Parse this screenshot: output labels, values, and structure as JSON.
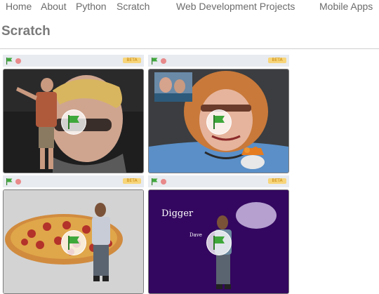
{
  "nav": {
    "items": [
      {
        "label": "Home"
      },
      {
        "label": "About"
      },
      {
        "label": "Python"
      },
      {
        "label": "Scratch"
      },
      {
        "label": "Web Development Projects"
      },
      {
        "label": "Mobile Apps"
      }
    ]
  },
  "page": {
    "title": "Scratch"
  },
  "players": [
    {
      "flag_icon": "green-flag-icon",
      "stop_icon": "stop-icon",
      "beta_icon": "beta-badge"
    },
    {
      "flag_icon": "green-flag-icon",
      "stop_icon": "stop-icon",
      "beta_icon": "beta-badge"
    },
    {
      "flag_icon": "green-flag-icon",
      "stop_icon": "stop-icon",
      "beta_icon": "beta-badge"
    },
    {
      "flag_icon": "green-flag-icon",
      "stop_icon": "stop-icon",
      "beta_icon": "beta-badge",
      "stage_title": "Digger",
      "stage_caption": "Dave"
    }
  ],
  "colors": {
    "nav_text": "#6b6b6b",
    "title_text": "#7a7a7a",
    "control_bar": "#e8ebef",
    "flag_green": "#3fa83b",
    "stop_red": "#e8898a",
    "beta_orange": "#f7d57a",
    "digger_stage_bg": "#33075f"
  }
}
